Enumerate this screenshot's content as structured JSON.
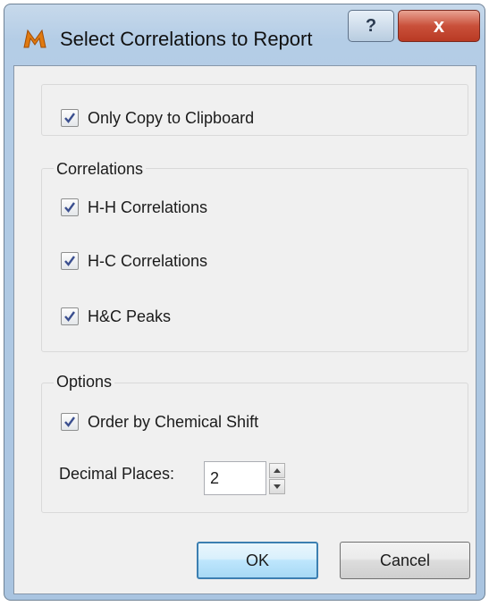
{
  "window": {
    "title": "Select Correlations to Report",
    "help_label": "?",
    "close_label": "x"
  },
  "top_group": {
    "only_copy": {
      "label": "Only Copy to Clipboard",
      "checked": true
    }
  },
  "correlations": {
    "title": "Correlations",
    "items": [
      {
        "label": "H-H Correlations",
        "checked": true
      },
      {
        "label": "H-C Correlations",
        "checked": true
      },
      {
        "label": "H&C Peaks",
        "checked": true
      }
    ]
  },
  "options": {
    "title": "Options",
    "order_by": {
      "label": "Order by Chemical Shift",
      "checked": true
    },
    "decimal_places": {
      "label": "Decimal Places:",
      "value": "2"
    }
  },
  "buttons": {
    "ok": "OK",
    "cancel": "Cancel"
  }
}
